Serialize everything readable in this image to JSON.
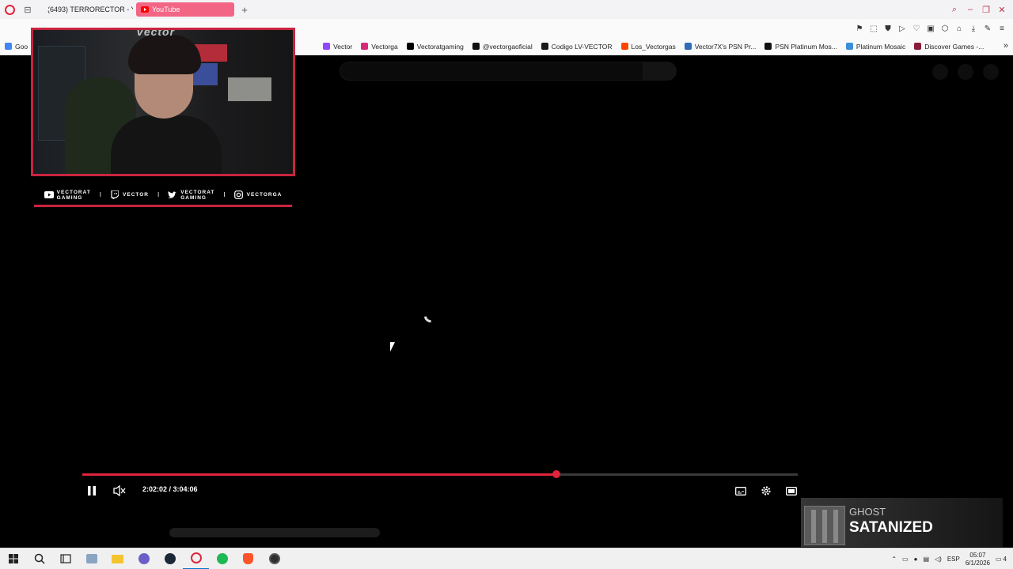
{
  "browser": {
    "tabs": [
      {
        "label": "(6493) TERRORECTOR - Y",
        "active": false
      },
      {
        "label": "YouTube",
        "active": true
      }
    ],
    "accent": "#e0243b"
  },
  "bookmarks": [
    {
      "label": "Goo",
      "color": "#4285f4"
    },
    {
      "label": "Vector",
      "color": "#9146ff"
    },
    {
      "label": "Vectorga",
      "color": "#d62976"
    },
    {
      "label": "Vectoratgaming",
      "color": "#000000"
    },
    {
      "label": "@vectorgaoficial",
      "color": "#111111"
    },
    {
      "label": "Codigo LV-VECTOR",
      "color": "#1a1a1a"
    },
    {
      "label": "Los_Vectorgas",
      "color": "#ff4500"
    },
    {
      "label": "Vector7X's PSN Pr...",
      "color": "#2f6db5"
    },
    {
      "label": "PSN Platinum Mos...",
      "color": "#111111"
    },
    {
      "label": "Platinum Mosaic",
      "color": "#3a8fd8"
    },
    {
      "label": "Discover Games -...",
      "color": "#8b1d3a"
    }
  ],
  "player": {
    "current_time": "2:02:02",
    "duration": "3:04:06",
    "time_display": "2:02:02 / 3:04:06",
    "progress_fraction": 0.663,
    "accent": "#e0243b"
  },
  "webcam": {
    "watermark": "Vector",
    "border_color": "#c9243f",
    "socials": [
      {
        "icon": "youtube-icon",
        "line1": "VECTORAT",
        "line2": "GAMING"
      },
      {
        "icon": "twitch-icon",
        "line1": "VECTOR",
        "line2": ""
      },
      {
        "icon": "twitter-icon",
        "line1": "VECTORAT",
        "line2": "GAMING"
      },
      {
        "icon": "instagram-icon",
        "line1": "VECTORGA",
        "line2": ""
      }
    ]
  },
  "achievement": {
    "line1": "GHOST",
    "line2": "SATANIZED"
  },
  "taskbar": {
    "language": "ESP",
    "time": "05:07",
    "date": "6/1/2026",
    "notifications": "4"
  }
}
